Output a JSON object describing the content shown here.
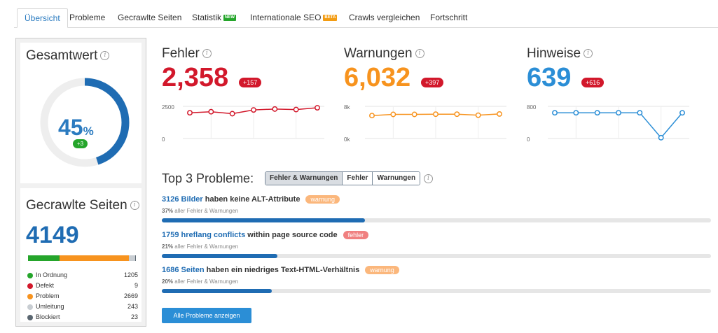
{
  "tabs": [
    {
      "label": "Übersicht"
    },
    {
      "label": "Probleme"
    },
    {
      "label": "Gecrawlte Seiten"
    },
    {
      "label": "Statistik",
      "badge": "NEW",
      "badge_color": "#25a52b"
    },
    {
      "label": "Internationale SEO",
      "badge": "BETA",
      "badge_color": "#f39c12"
    },
    {
      "label": "Crawls vergleichen"
    },
    {
      "label": "Fortschritt"
    }
  ],
  "gesamtwert": {
    "title": "Gesamtwert",
    "value": "45",
    "unit": "%",
    "delta": "+3",
    "fraction": 0.45
  },
  "gecrawlte": {
    "title": "Gecrawlte Seiten",
    "value": "4149",
    "legend": [
      {
        "label": "In Ordnung",
        "value": "1205",
        "color": "#25a52b"
      },
      {
        "label": "Defekt",
        "value": "9",
        "color": "#d2182b"
      },
      {
        "label": "Problem",
        "value": "2669",
        "color": "#f7931e"
      },
      {
        "label": "Umleitung",
        "value": "243",
        "color": "#c8cdd2"
      },
      {
        "label": "Blockiert",
        "value": "23",
        "color": "#5a6670"
      }
    ]
  },
  "metrics": {
    "fehler": {
      "title": "Fehler",
      "value": "2,358",
      "delta": "+157",
      "color": "#d2182b",
      "y_top_label": "2500",
      "y_bottom_label": "0",
      "points": [
        2000,
        2080,
        1930,
        2220,
        2290,
        2250,
        2390
      ]
    },
    "warnungen": {
      "title": "Warnungen",
      "value": "6,032",
      "delta": "+397",
      "color": "#f7931e",
      "y_top_label": "8k",
      "y_bottom_label": "0k",
      "points": [
        5700,
        6000,
        6000,
        6050,
        6050,
        5800,
        6100
      ]
    },
    "hinweise": {
      "title": "Hinweise",
      "value": "639",
      "delta": "+616",
      "color": "#2b8ed6",
      "y_top_label": "800",
      "y_bottom_label": "0",
      "points": [
        640,
        640,
        640,
        640,
        640,
        20,
        639
      ]
    }
  },
  "top": {
    "title": "Top 3 Probleme:",
    "filters": [
      "Fehler & Warnungen",
      "Fehler",
      "Warnungen"
    ],
    "items": [
      {
        "link": "3126 Bilder",
        "text": " haben keine ALT-Attribute",
        "tag": "warnung",
        "tag_color": "#fbb77c",
        "pct": "37%",
        "pct_text": " aller Fehler & Warnungen",
        "fraction": 0.37
      },
      {
        "link": "1759 hreflang conflicts",
        "text": " within page source code",
        "tag": "fehler",
        "tag_color": "#f08080",
        "pct": "21%",
        "pct_text": " aller Fehler & Warnungen",
        "fraction": 0.21
      },
      {
        "link": "1686 Seiten",
        "text": " haben ein niedriges Text-HTML-Verhältnis",
        "tag": "warnung",
        "tag_color": "#fbb77c",
        "pct": "20%",
        "pct_text": " aller Fehler & Warnungen",
        "fraction": 0.2
      }
    ],
    "button": "Alle Probleme anzeigen"
  }
}
